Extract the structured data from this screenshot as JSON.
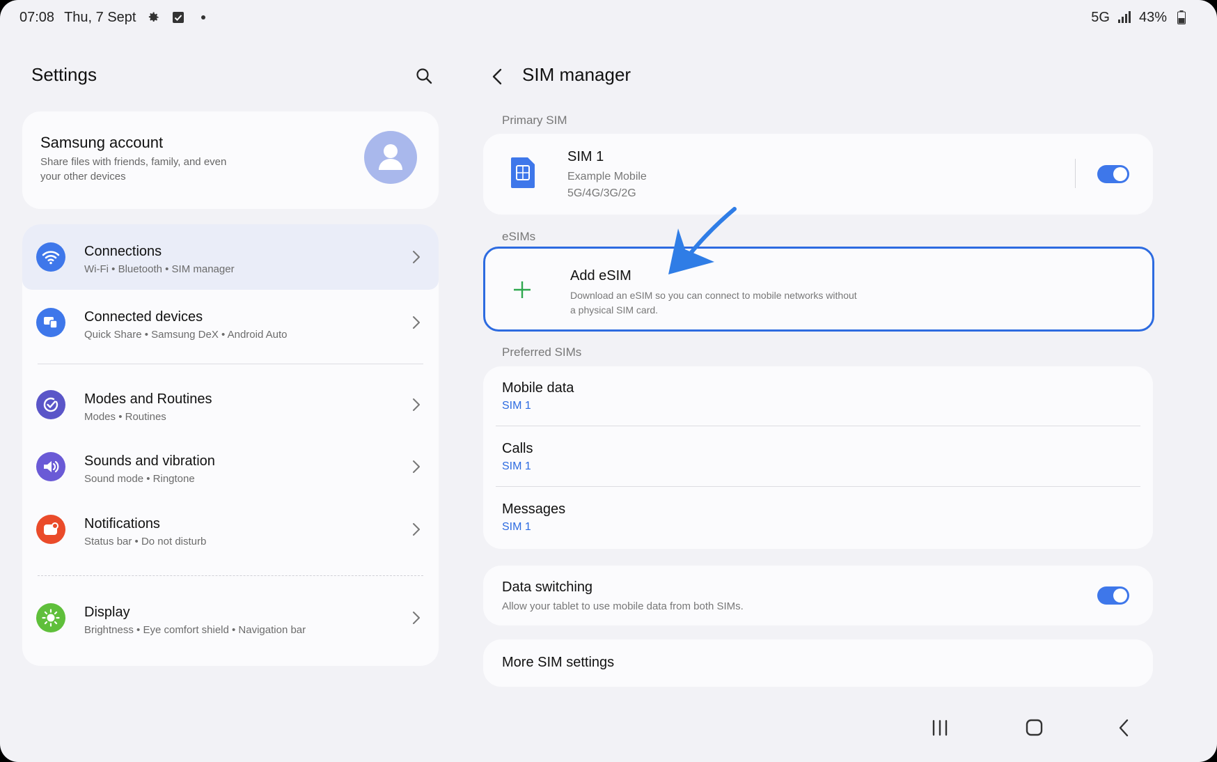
{
  "status_bar": {
    "time": "07:08",
    "date": "Thu, 7 Sept",
    "network": "5G",
    "battery": "43%",
    "icons": [
      "settings-gear-icon",
      "checkbox-icon",
      "dot-icon",
      "signal-bars-icon",
      "battery-icon"
    ]
  },
  "left_pane": {
    "title": "Settings",
    "account": {
      "title": "Samsung account",
      "subtitle": "Share files with friends, family, and even your other devices"
    },
    "menu": [
      {
        "title": "Connections",
        "subtitle": "Wi-Fi  •  Bluetooth  •  SIM manager",
        "icon": "wifi-icon",
        "color": "#3e77ea",
        "selected": true
      },
      {
        "title": "Connected devices",
        "subtitle": "Quick Share  •  Samsung DeX  •  Android Auto",
        "icon": "devices-icon",
        "color": "#3e77ea"
      },
      {
        "title": "Modes and Routines",
        "subtitle": "Modes  •  Routines",
        "icon": "routine-check-icon",
        "color": "#5a55c8"
      },
      {
        "title": "Sounds and vibration",
        "subtitle": "Sound mode  •  Ringtone",
        "icon": "speaker-icon",
        "color": "#6a5ad6"
      },
      {
        "title": "Notifications",
        "subtitle": "Status bar  •  Do not disturb",
        "icon": "notification-icon",
        "color": "#ea4b2a"
      },
      {
        "title": "Display",
        "subtitle": "Brightness  •  Eye comfort shield  •  Navigation bar",
        "icon": "sun-icon",
        "color": "#5fbf3b"
      }
    ]
  },
  "right_pane": {
    "title": "SIM manager",
    "primary_label": "Primary SIM",
    "sim": {
      "title": "SIM 1",
      "carrier": "Example Mobile",
      "networks": "5G/4G/3G/2G",
      "enabled": true
    },
    "esims_label": "eSIMs",
    "add_esim": {
      "title": "Add eSIM",
      "subtitle": "Download an eSIM so you can connect to mobile networks without a physical SIM card."
    },
    "preferred_label": "Preferred SIMs",
    "preferred": [
      {
        "title": "Mobile data",
        "value": "SIM 1"
      },
      {
        "title": "Calls",
        "value": "SIM 1"
      },
      {
        "title": "Messages",
        "value": "SIM 1"
      }
    ],
    "data_switching": {
      "title": "Data switching",
      "subtitle": "Allow your tablet to use mobile data from both SIMs.",
      "enabled": true
    },
    "more": "More SIM settings"
  },
  "colors": {
    "accent": "#3e77ea",
    "highlight_border": "#2d6be0",
    "plus_green": "#2fa84f"
  }
}
